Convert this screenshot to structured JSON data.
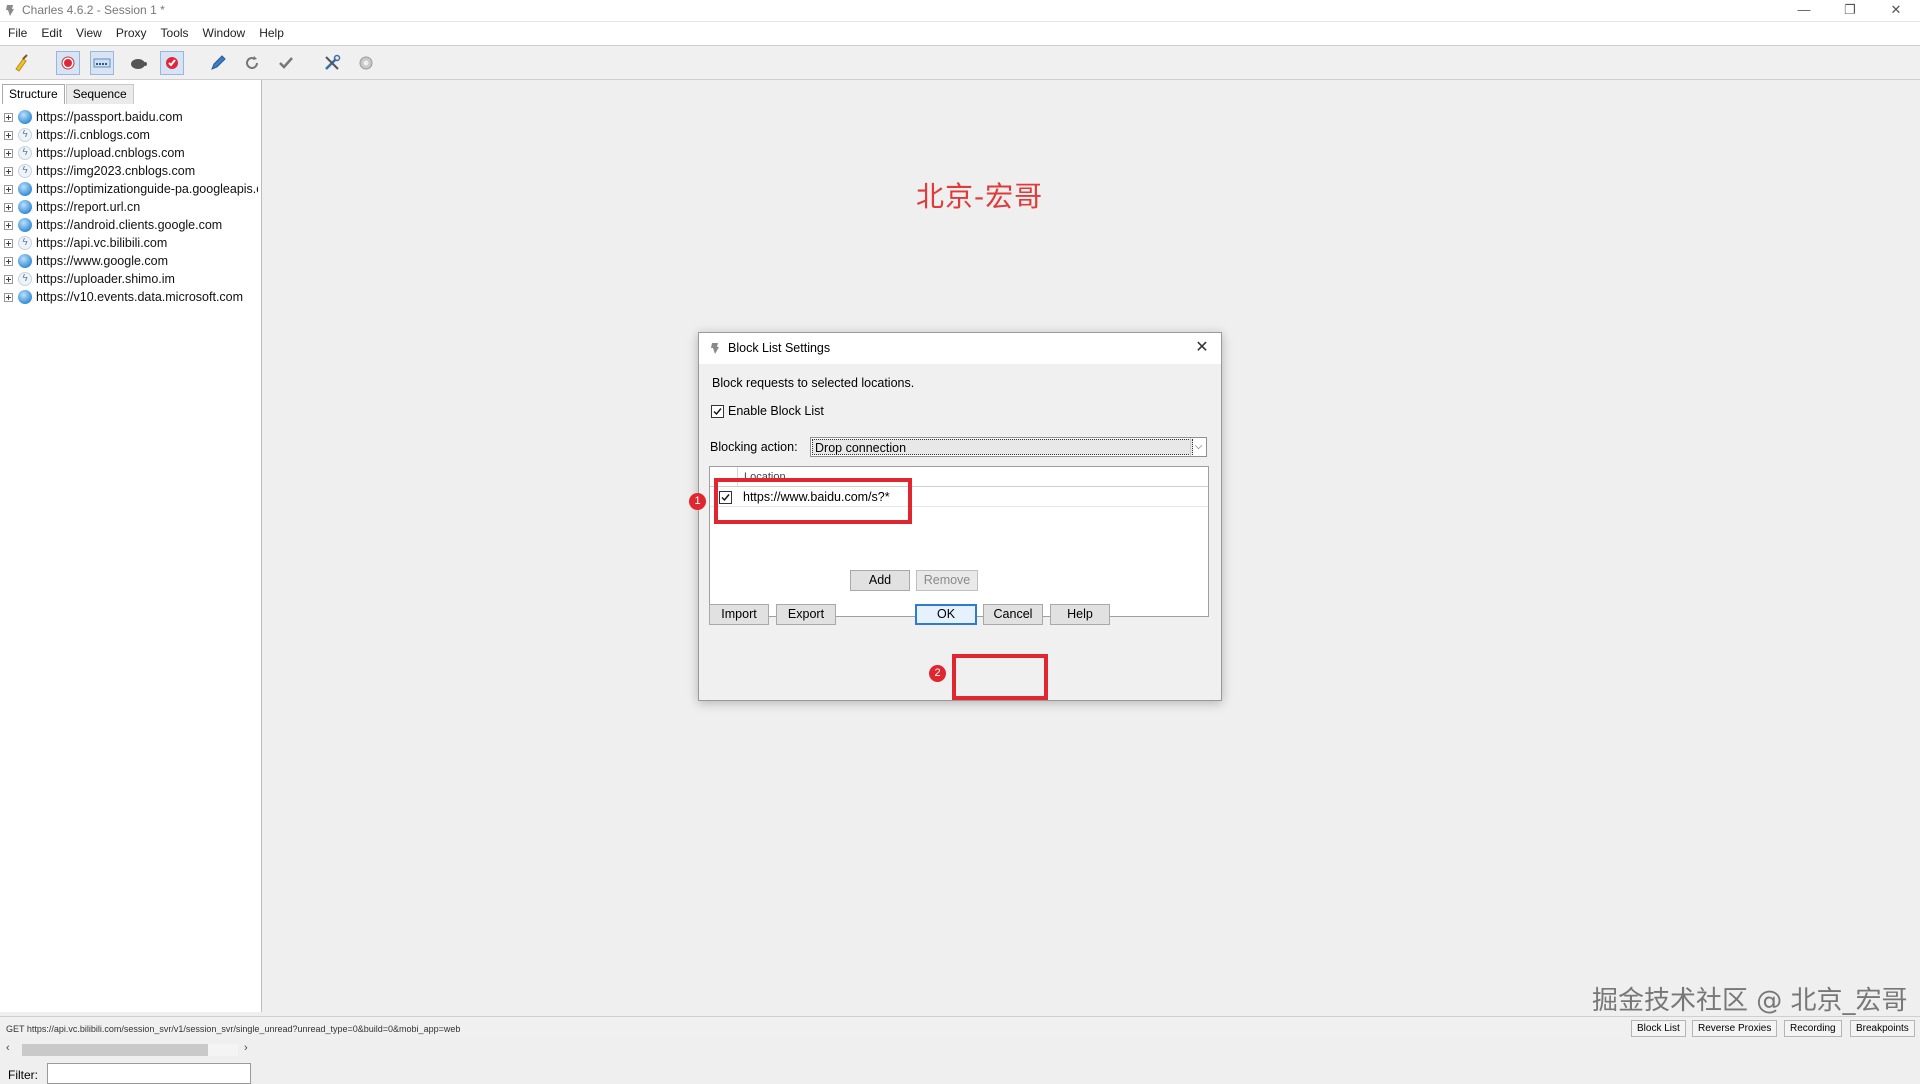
{
  "window": {
    "title": "Charles 4.6.2 - Session 1 *",
    "controls": {
      "minimize": "—",
      "restore": "❐",
      "close": "✕"
    }
  },
  "menu": [
    "File",
    "Edit",
    "View",
    "Proxy",
    "Tools",
    "Window",
    "Help"
  ],
  "toolbar": {
    "icons": [
      "broom-icon",
      "record-icon",
      "throttle-icon",
      "turtle-icon",
      "breakpoints-icon",
      "compose-icon",
      "repeat-icon",
      "validate-icon",
      "tools-icon",
      "settings-icon"
    ],
    "pressed": [
      "record-icon",
      "throttle-icon",
      "breakpoints-icon"
    ],
    "colors": {
      "record": "#e5243b",
      "pressed_bg": "#d6e4f5"
    }
  },
  "sidebar": {
    "tabs": [
      "Structure",
      "Sequence"
    ],
    "active_tab": "Structure",
    "hosts": [
      {
        "label": "https://passport.baidu.com",
        "icon": "globe-icon"
      },
      {
        "label": "https://i.cnblogs.com",
        "icon": "bolt-icon"
      },
      {
        "label": "https://upload.cnblogs.com",
        "icon": "bolt-icon"
      },
      {
        "label": "https://img2023.cnblogs.com",
        "icon": "bolt-icon"
      },
      {
        "label": "https://optimizationguide-pa.googleapis.com",
        "icon": "globe-icon"
      },
      {
        "label": "https://report.url.cn",
        "icon": "globe-icon"
      },
      {
        "label": "https://android.clients.google.com",
        "icon": "globe-icon"
      },
      {
        "label": "https://api.vc.bilibili.com",
        "icon": "bolt-icon"
      },
      {
        "label": "https://www.google.com",
        "icon": "globe-icon"
      },
      {
        "label": "https://uploader.shimo.im",
        "icon": "bolt-icon"
      },
      {
        "label": "https://v10.events.data.microsoft.com",
        "icon": "globe-icon"
      }
    ],
    "filter_label": "Filter:",
    "filter_value": ""
  },
  "watermarks": {
    "top": "北京-宏哥",
    "bottom": "掘金技术社区 @ 北京_宏哥",
    "top_color": "#e23a3a"
  },
  "dialog": {
    "title": "Block List Settings",
    "description": "Block requests to selected locations.",
    "enable_label": "Enable Block List",
    "enable_checked": true,
    "blocking_label": "Blocking action:",
    "blocking_value": "Drop connection",
    "table_header": "Location",
    "locations": [
      {
        "value": "https://www.baidu.com/s?*",
        "checked": true
      }
    ],
    "buttons": {
      "add": "Add",
      "remove": "Remove",
      "import": "Import",
      "export": "Export",
      "ok": "OK",
      "cancel": "Cancel",
      "help": "Help"
    },
    "close": "✕"
  },
  "annotations": {
    "badge1": "1",
    "badge2": "2",
    "color": "#e0262e"
  },
  "statusbar": {
    "text": "GET https://api.vc.bilibili.com/session_svr/v1/session_svr/single_unread?unread_type=0&build=0&mobi_app=web",
    "buttons": [
      "Block List",
      "Reverse Proxies",
      "Recording",
      "Breakpoints"
    ]
  }
}
